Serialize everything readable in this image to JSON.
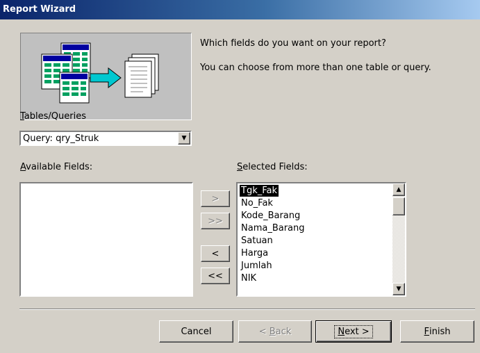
{
  "window": {
    "title": "Report Wizard"
  },
  "prompt": {
    "line1": "Which fields do you want on your report?",
    "line2": "You can choose from more than one table or query."
  },
  "tables_queries": {
    "label_mnemonic": "T",
    "label_rest": "ables/Queries",
    "value": "Query: qry_Struk"
  },
  "available_fields": {
    "label_mnemonic": "A",
    "label_rest": "vailable Fields:",
    "items": []
  },
  "selected_fields": {
    "label_mnemonic": "S",
    "label_rest": "elected Fields:",
    "items": [
      "Tgk_Fak",
      "No_Fak",
      "Kode_Barang",
      "Nama_Barang",
      "Satuan",
      "Harga",
      "Jumlah",
      "NIK"
    ],
    "selected_index": 0
  },
  "move_buttons": {
    "add_one": ">",
    "add_all": ">>",
    "remove_one": "<",
    "remove_all": "<<"
  },
  "footer": {
    "cancel": "Cancel",
    "back_prefix": "< ",
    "back_mnemonic": "B",
    "back_rest": "ack",
    "next_mnemonic": "N",
    "next_rest": "ext >",
    "finish_mnemonic": "F",
    "finish_rest": "inish"
  },
  "icons": {
    "dropdown": "chevron-down-icon",
    "scroll_up": "scroll-up-icon",
    "scroll_down": "scroll-down-icon",
    "illustration": "tables-to-report-icon"
  },
  "colors": {
    "title_start": "#0a246a",
    "title_end": "#a6caf0",
    "dialog_bg": "#d4d0c8",
    "arrow": "#00c8d0"
  }
}
